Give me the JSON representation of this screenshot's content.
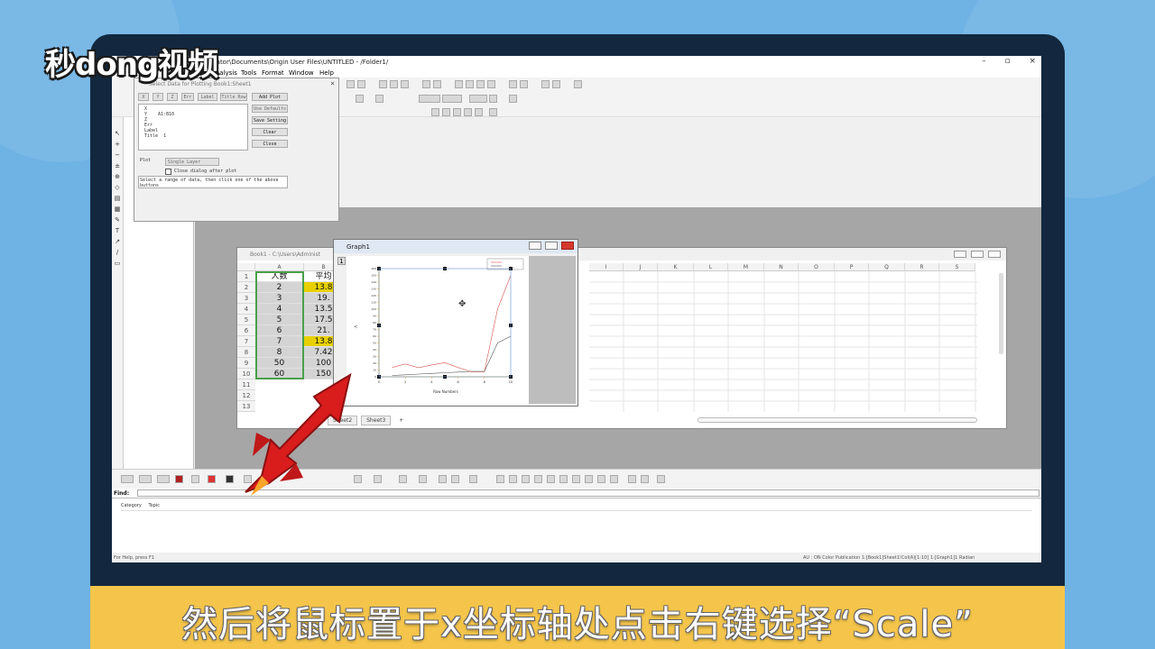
{
  "logo": {
    "text": "秒dong视频"
  },
  "subtitle": "然后将鼠标置于x坐标轴处点击右键选择“Scale”",
  "window": {
    "title": "nistrator\\Documents\\Origin User Files\\UNTITLED - /Folder1/",
    "buttons": [
      "–",
      "▫",
      "×"
    ]
  },
  "menu": [
    "a",
    "Analysis",
    "Tools",
    "Format",
    "Window",
    "Help"
  ],
  "dialog": {
    "title": "Select Data for Plotting  Book1:Sheet1",
    "close": "×",
    "top_buttons": [
      "X",
      "Y",
      "Z",
      "Err",
      "Label",
      "Title Row"
    ],
    "side_buttons": [
      "Add Plot",
      "Use Defaults",
      "Save Setting",
      "Clear",
      "Close"
    ],
    "fields": "X\nY    A1:B10\nZ\nErr\nLabel\nTitle  1",
    "plot_label": "Plot",
    "plot_select": "Single Layer",
    "close_after_plot": "Close dialog after plot",
    "note": "Select a range of data, then click one of the above buttons"
  },
  "book": {
    "title": "Book1 - C:\\Users\\Administ",
    "columns": [
      "A",
      "B",
      "I",
      "J",
      "K",
      "L",
      "M",
      "N",
      "O",
      "P",
      "Q",
      "R",
      "S"
    ],
    "rows": [
      "1",
      "2",
      "3",
      "4",
      "5",
      "6",
      "7",
      "8",
      "9",
      "10",
      "11",
      "12",
      "13"
    ],
    "colA": [
      "人数",
      "2",
      "3",
      "4",
      "5",
      "6",
      "7",
      "8",
      "50",
      "60"
    ],
    "colB": [
      "平均",
      "13.8",
      "19.",
      "13.5",
      "17.5",
      "21.",
      "13.8",
      "7.42",
      "100",
      "150"
    ],
    "highlighted_rows": [
      2,
      7
    ],
    "sheet_tabs": [
      "Sheet2",
      "Sheet3",
      "+"
    ]
  },
  "graph": {
    "title": "Graph1",
    "layer": "1",
    "xlabel": "Row Numbers",
    "ylabel": "<"
  },
  "find": {
    "label": "Find:"
  },
  "results": {
    "columns": [
      "Category",
      "Topic"
    ]
  },
  "status": {
    "left": "For Help, press F1",
    "right": "AU : ON   Color Publication       1:[Book1]Sheet1!Col(A)[1:10]      1:[Graph1]1    Radian"
  },
  "colors": {
    "background": "#6fb2e4",
    "frame": "#13283f",
    "subtitle_bar": "#f5c54b",
    "highlight": "#e8d000",
    "rocket": "#d91c1c"
  },
  "chart_data": {
    "type": "line",
    "x": [
      1,
      2,
      3,
      4,
      5,
      6,
      7,
      8,
      9,
      10
    ],
    "series": [
      {
        "values": [
          13.8,
          19,
          13.5,
          17.5,
          21,
          13.8,
          7.42,
          7.42,
          100,
          150
        ]
      },
      {
        "values": [
          2,
          3,
          4,
          5,
          6,
          7,
          8,
          8,
          50,
          60
        ]
      }
    ],
    "xlim": [
      0,
      10
    ],
    "ylim": [
      0,
      160
    ],
    "xticks": [
      0,
      2,
      4,
      6,
      8,
      10
    ],
    "yticks": [
      0,
      10,
      20,
      30,
      40,
      50,
      60,
      70,
      80,
      90,
      100,
      110,
      120,
      130,
      140,
      150,
      160
    ],
    "xlabel": "Row Numbers",
    "colors": [
      "#d9534f",
      "#555555"
    ]
  }
}
